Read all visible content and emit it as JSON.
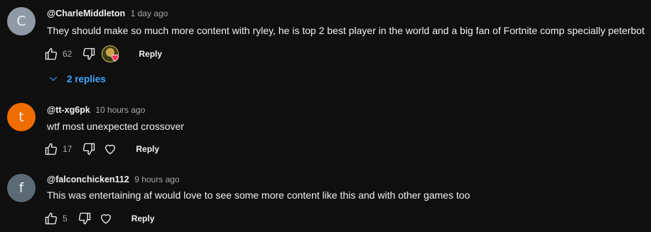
{
  "comments": [
    {
      "avatar_letter": "C",
      "avatar_color": "#8e9aa6",
      "author": "@CharleMiddleton",
      "time": "1 day ago",
      "text": "They should make so much more content with ryley, he is top 2 best player in the world and a big fan of Fortnite comp specially peterbot",
      "likes": "62",
      "reply_label": "Reply",
      "creator_heart": true,
      "replies_label": "2 replies"
    },
    {
      "avatar_letter": "t",
      "avatar_color": "#ef6c00",
      "author": "@tt-xg6pk",
      "time": "10 hours ago",
      "text": "wtf most unexpected crossover",
      "likes": "17",
      "reply_label": "Reply"
    },
    {
      "avatar_letter": "f",
      "avatar_color": "#5b6b75",
      "author": "@falconchicken112",
      "time": "9 hours ago",
      "text": "This was entertaining af would love to see some more content like this and with other games too",
      "likes": "5",
      "reply_label": "Reply"
    }
  ]
}
